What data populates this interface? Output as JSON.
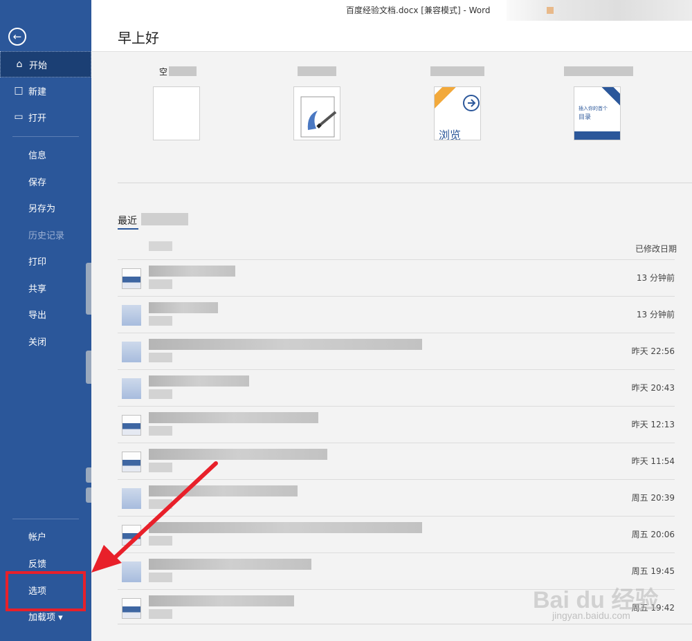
{
  "titlebar": {
    "doc_title": "百度经验文档.docx [兼容模式]  -  Word"
  },
  "sidebar": {
    "back_icon": "arrow-left-circle-icon",
    "top_items": [
      {
        "label": "开始",
        "icon": "home-icon"
      },
      {
        "label": "新建",
        "icon": "new-doc-icon"
      },
      {
        "label": "打开",
        "icon": "open-folder-icon"
      }
    ],
    "mid_items": [
      "信息",
      "保存",
      "另存为",
      "历史记录",
      "打印",
      "共享",
      "导出",
      "关闭"
    ],
    "bottom_items": [
      "帐户",
      "反馈",
      "选项",
      "加载项 ▾"
    ]
  },
  "header": {
    "greeting": "早上好"
  },
  "templates": [
    {
      "label": "空"
    },
    {
      "label": ""
    },
    {
      "label": "",
      "card_text": "浏览"
    },
    {
      "label": "",
      "card_text_small": "插入你的首个",
      "card_text": "目录"
    }
  ],
  "recent": {
    "title": "最近",
    "column_header": "已修改日期",
    "rows": [
      {
        "date": "13 分钟前",
        "icon": "doc"
      },
      {
        "date": "13 分钟前",
        "icon": "generic"
      },
      {
        "date": "昨天 22:56",
        "icon": "generic"
      },
      {
        "date": "昨天 20:43",
        "icon": "generic"
      },
      {
        "date": "昨天 12:13",
        "icon": "doc"
      },
      {
        "date": "昨天 11:54",
        "icon": "doc"
      },
      {
        "date": "周五 20:39",
        "icon": "generic"
      },
      {
        "date": "周五 20:06",
        "icon": "doc"
      },
      {
        "date": "周五 19:45",
        "icon": "generic"
      },
      {
        "date": "周五 19:42",
        "icon": "doc"
      }
    ]
  },
  "watermark": {
    "logo": "Bai du 经验",
    "url": "jingyan.baidu.com"
  }
}
